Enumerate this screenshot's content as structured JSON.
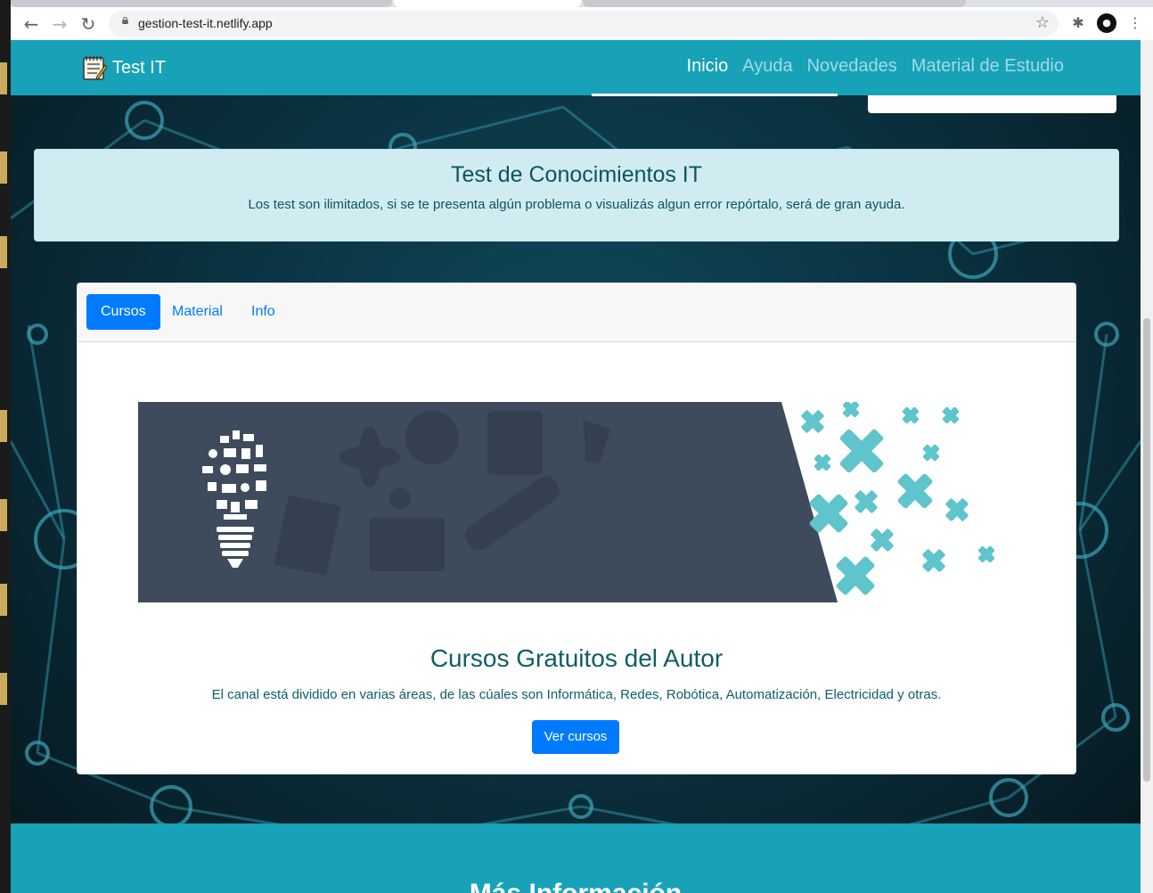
{
  "browser": {
    "url": "gestion-test-it.netlify.app",
    "back_icon": "←",
    "forward_icon": "→",
    "reload_icon": "↻",
    "star_icon": "☆",
    "extensions_icon": "✱",
    "menu_icon": "⋮"
  },
  "navbar": {
    "brand": "Test IT",
    "links": [
      "Inicio",
      "Ayuda",
      "Novedades",
      "Material de Estudio"
    ],
    "active_index": 0
  },
  "alert": {
    "title": "Test de Conocimientos IT",
    "text": "Los test son ilimitados, si se te presenta algún problema o visualizás algun error repórtalo, será de gran ayuda."
  },
  "card": {
    "tabs": [
      "Cursos",
      "Material",
      "Info"
    ],
    "active_tab": 0,
    "title": "Cursos Gratuitos del Autor",
    "text": "El canal está dividido en varias áreas, de las cúales son Informática, Redes, Robótica, Automatización, Electricidad y otras.",
    "button": "Ver cursos"
  },
  "footer": {
    "title": "Más Información"
  },
  "colors": {
    "primary": "#007bff",
    "navbar": "#17a2b8",
    "alert_bg": "#d1ecf1",
    "alert_text": "#0c5460",
    "banner_dark": "#3d4b5d",
    "banner_accent": "#5fc4cb"
  }
}
